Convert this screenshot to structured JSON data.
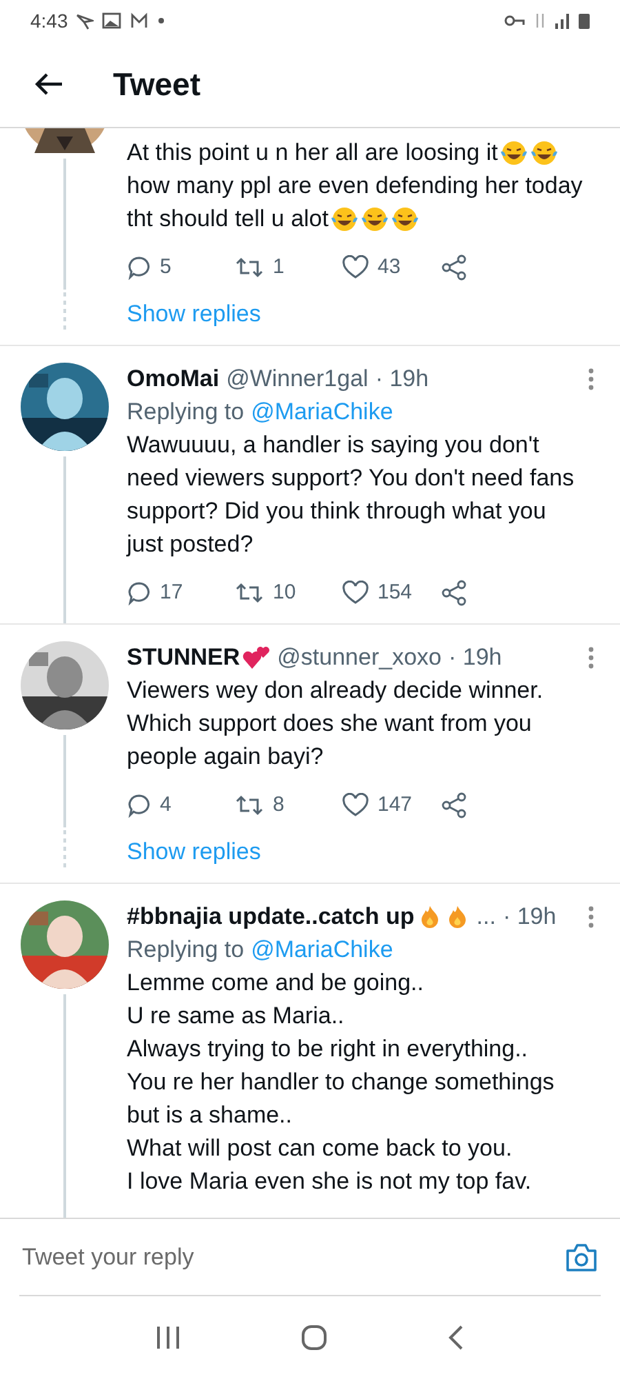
{
  "status_bar": {
    "time": "4:43"
  },
  "header": {
    "title": "Tweet"
  },
  "tweets": [
    {
      "cut_top": true,
      "lines": [
        {
          "text": "At this point u n her all are loosing it",
          "kind": "laughs-2"
        },
        {
          "text": "how many ppl are even defending her today",
          "kind": "plain"
        },
        {
          "text": "tht should tell u alot",
          "kind": "laughs-3"
        }
      ],
      "stats": {
        "replies": "5",
        "retweets": "1",
        "likes": "43"
      },
      "show_replies": "Show replies"
    },
    {
      "cut_top": false,
      "name": "OmoMai",
      "kind": "plain",
      "handle": "@Winner1gal",
      "time": "· 19h",
      "replying_label": "Replying to",
      "replying_to": "@MariaChike",
      "lines": [
        {
          "text": "Wawuuuu, a handler is saying you don't",
          "kind": "plain"
        },
        {
          "text": "need viewers support? You don't need fans",
          "kind": "plain"
        },
        {
          "text": "support? Did you think through what you",
          "kind": "plain"
        },
        {
          "text": "just posted?",
          "kind": "plain"
        }
      ],
      "stats": {
        "replies": "17",
        "retweets": "10",
        "likes": "154"
      }
    },
    {
      "cut_top": false,
      "name": "STUNNER",
      "kind": "hearts",
      "handle": "@stunner_xoxo",
      "time": "· 19h",
      "lines": [
        {
          "text": "Viewers wey don already decide winner.",
          "kind": "plain"
        },
        {
          "text": "Which support does she want from you",
          "kind": "plain"
        },
        {
          "text": "people again bayi?",
          "kind": "plain"
        }
      ],
      "stats": {
        "replies": "4",
        "retweets": "8",
        "likes": "147"
      },
      "show_replies": "Show replies"
    },
    {
      "cut_top": false,
      "name": "#bbnajia update..catch up",
      "kind": "fire-2",
      "handle": "...",
      "time": "· 19h",
      "replying_label": "Replying to",
      "replying_to": "@MariaChike",
      "lines": [
        {
          "text": "Lemme come and be going..",
          "kind": "plain"
        },
        {
          "text": "U re same as Maria..",
          "kind": "plain"
        },
        {
          "text": "Always trying to be right in everything..",
          "kind": "plain"
        },
        {
          "text": "You re her handler to change somethings",
          "kind": "plain"
        },
        {
          "text": "but is a shame..",
          "kind": "plain"
        },
        {
          "text": "What will post can come back to you.",
          "kind": "plain"
        },
        {
          "text": "I love Maria even she is not my top fav.",
          "kind": "plain"
        }
      ]
    }
  ],
  "reply_bar": {
    "placeholder": "Tweet your reply"
  }
}
